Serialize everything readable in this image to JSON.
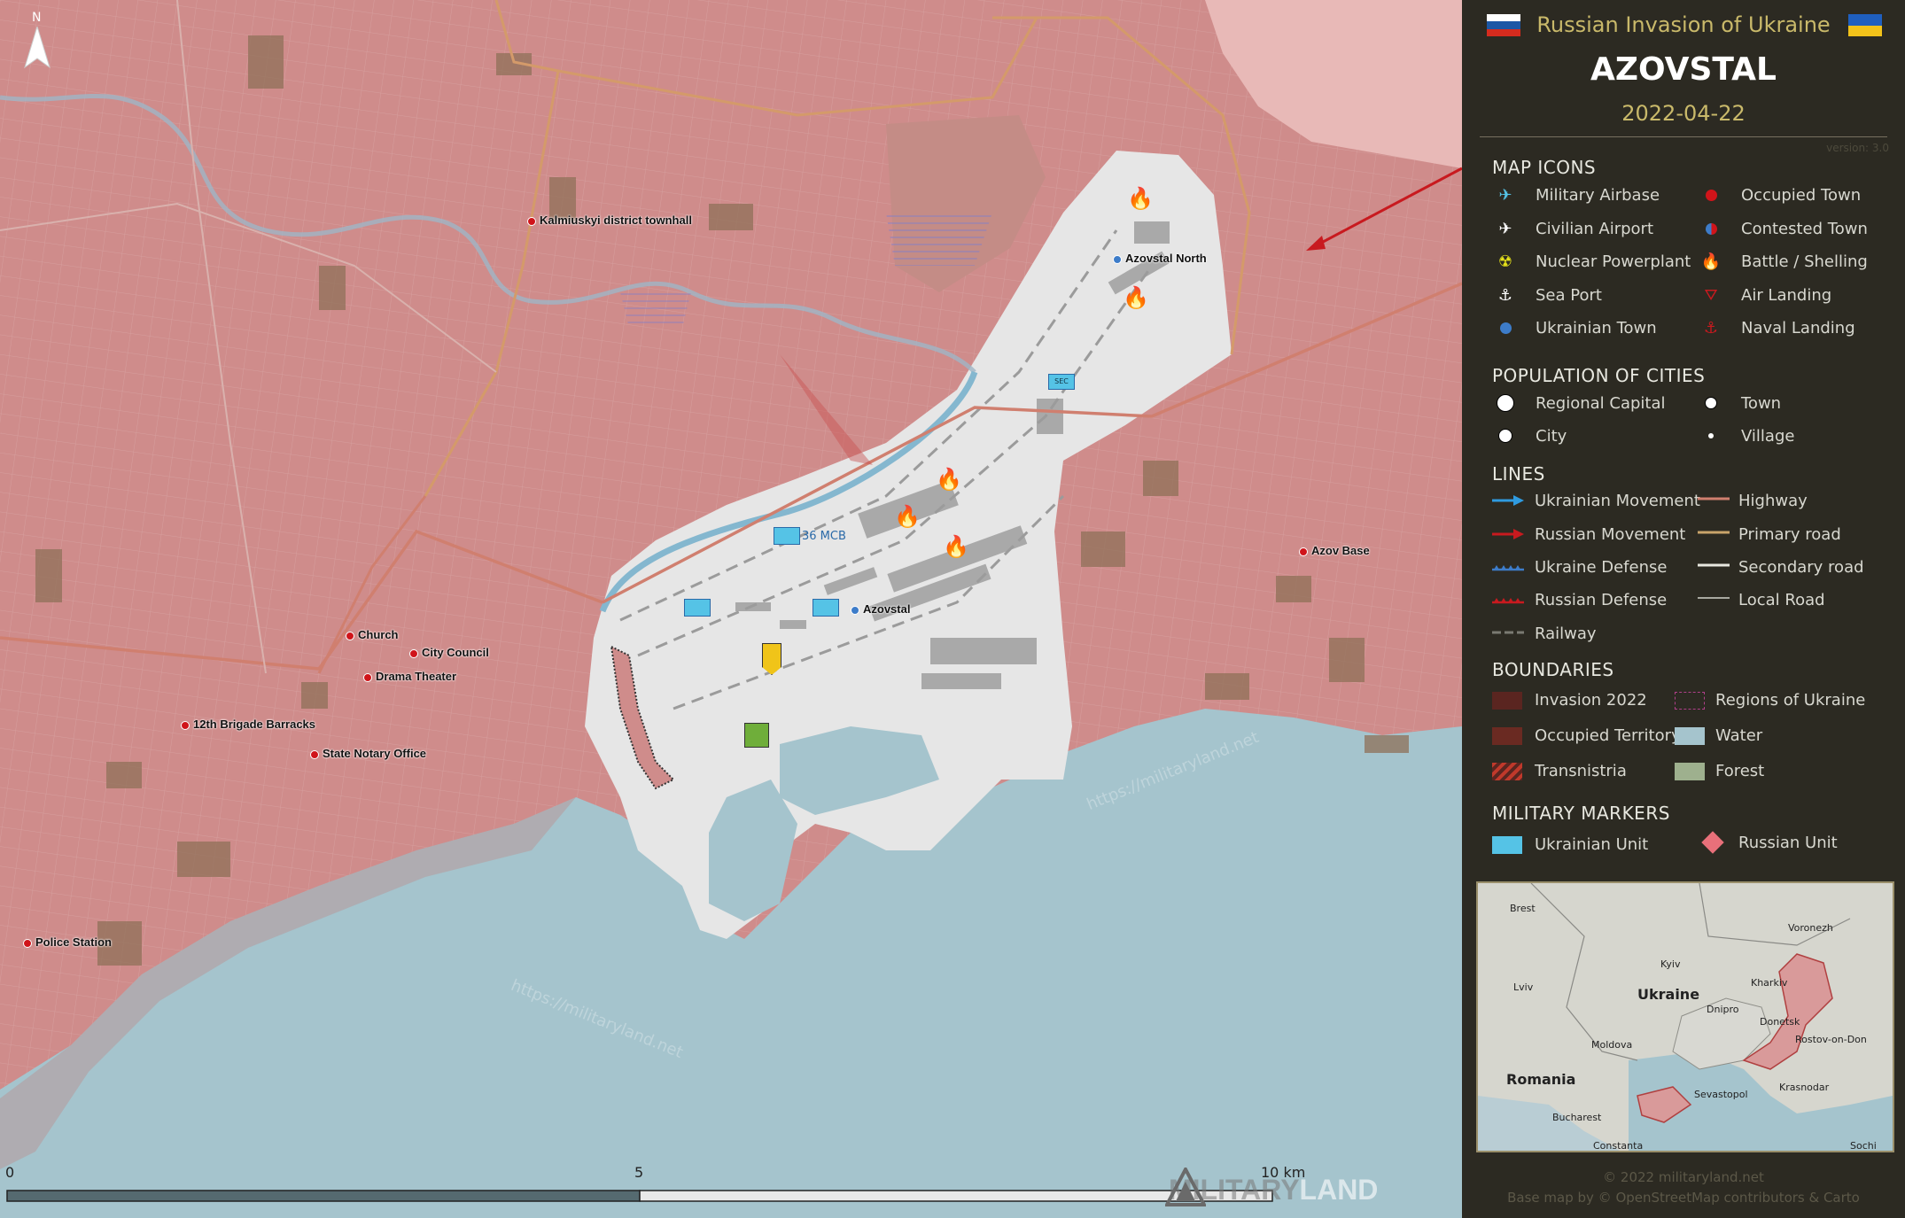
{
  "header": {
    "subtitle": "Russian Invasion of Ukraine",
    "title": "AZOVSTAL",
    "date": "2022-04-22",
    "version": "version: 3.0"
  },
  "colors": {
    "occupied": "#cf8c8b",
    "liberated_free": "#e8e8e8",
    "water": "#a5c4cd",
    "panel_bg": "#2c2a22",
    "accent": "#c9b96a",
    "russia_red": "#c81a1f",
    "ukraine_blue": "#55c3e6"
  },
  "map": {
    "north_label": "N",
    "places": [
      {
        "name": "Kalmiuskyi district townhall"
      },
      {
        "name": "Azovstal North"
      },
      {
        "name": "Azovstal"
      },
      {
        "name": "Azov Base"
      },
      {
        "name": "Church"
      },
      {
        "name": "City Council"
      },
      {
        "name": "Drama Theater"
      },
      {
        "name": "12th Brigade Barracks"
      },
      {
        "name": "State Notary Office"
      },
      {
        "name": "Police Station"
      }
    ],
    "units": {
      "mcb_label": "36 МСВ",
      "sec_label": "SEC"
    },
    "watermark": "https://militaryland.net",
    "scale": {
      "zero": "0",
      "mid": "5",
      "end": "10 km"
    },
    "logo": {
      "part1": "MILITARY",
      "part2": "LAND"
    }
  },
  "legend": {
    "map_icons": {
      "title": "MAP ICONS",
      "left": [
        "Military Airbase",
        "Civilian Airport",
        "Nuclear Powerplant",
        "Sea Port",
        "Ukrainian Town"
      ],
      "right": [
        "Occupied Town",
        "Contested Town",
        "Battle / Shelling",
        "Air Landing",
        "Naval Landing"
      ]
    },
    "population": {
      "title": "POPULATION OF CITIES",
      "items": [
        "Regional Capital",
        "Town",
        "City",
        "Village"
      ]
    },
    "lines": {
      "title": "LINES",
      "left": [
        "Ukrainian Movement",
        "Russian Movement",
        "Ukraine Defense",
        "Russian Defense",
        "Railway"
      ],
      "right": [
        "Highway",
        "Primary road",
        "Secondary road",
        "Local Road"
      ]
    },
    "boundaries": {
      "title": "BOUNDARIES",
      "left": [
        "Invasion 2022",
        "Occupied Territory",
        "Transnistria"
      ],
      "right": [
        "Regions of Ukraine",
        "Water",
        "Forest"
      ]
    },
    "military": {
      "title": "MILITARY MARKERS",
      "items": [
        "Ukrainian Unit",
        "Russian Unit"
      ]
    }
  },
  "inset": {
    "labels": [
      "Brest",
      "Voronezh",
      "Kyiv",
      "Lviv",
      "Ukraine",
      "Kharkiv",
      "Dnipro",
      "Donetsk",
      "Rostov-on-Don",
      "Moldova",
      "Romania",
      "Krasnodar",
      "Sevastopol",
      "Bucharest",
      "Constanta",
      "Sochi"
    ]
  },
  "footer": {
    "copyright": "© 2022 militaryland.net",
    "basemap": "Base map by © OpenStreetMap contributors & Carto"
  }
}
